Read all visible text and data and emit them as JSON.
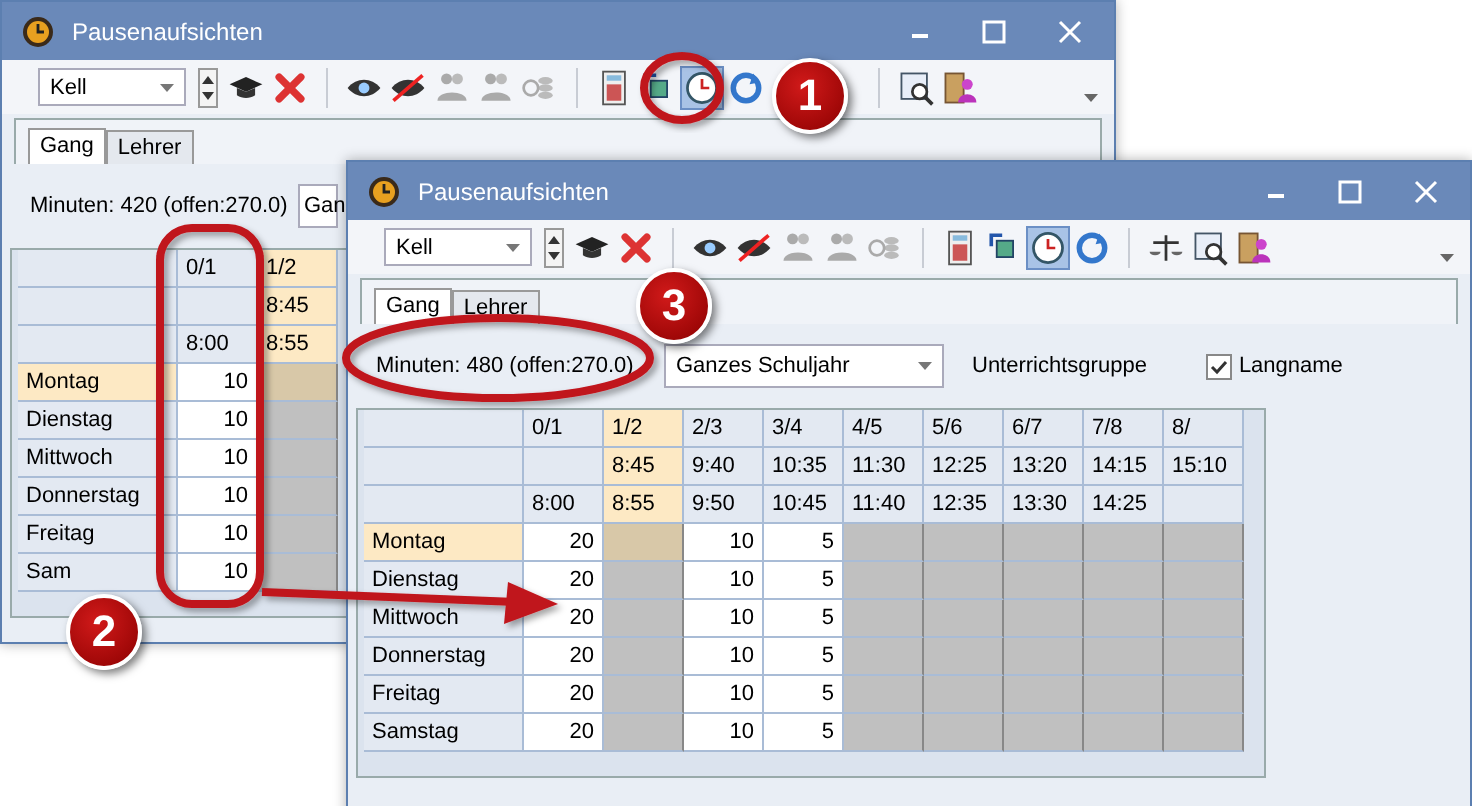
{
  "windows": [
    {
      "title": "Pausenaufsichten",
      "teacher_select": {
        "value": "Kell"
      },
      "toolbar": [
        {
          "kind": "cap",
          "selected": false
        },
        {
          "kind": "delete",
          "selected": false
        },
        {
          "kind": "eye",
          "selected": false
        },
        {
          "kind": "eye-off",
          "selected": false
        },
        {
          "kind": "people",
          "selected": false
        },
        {
          "kind": "people",
          "selected": false
        },
        {
          "kind": "coins",
          "selected": false
        },
        {
          "kind": "calculator",
          "selected": false
        },
        {
          "kind": "rotate",
          "selected": false
        },
        {
          "kind": "clock",
          "selected": true
        },
        {
          "kind": "refresh",
          "selected": false
        },
        {
          "kind": "magnifier",
          "selected": false
        },
        {
          "kind": "door",
          "selected": false
        }
      ],
      "tabs": [
        {
          "label": "Gang",
          "selected": true
        },
        {
          "label": "Lehrer",
          "selected": false
        }
      ],
      "minutes": "Minuten: 420 (offen:270.0)",
      "period_select": {
        "value": "Gan"
      },
      "table": {
        "columns": [
          {
            "period": "0/1",
            "end": "8:00",
            "selected": false
          },
          {
            "period": "1/2",
            "start": "8:45",
            "end": "8:55",
            "selected": true
          }
        ],
        "rows": [
          {
            "day": "Montag",
            "selected": true,
            "cells": [
              {
                "text": "10",
                "blocked": false
              },
              {
                "blocked": true
              }
            ]
          },
          {
            "day": "Dienstag",
            "selected": false,
            "cells": [
              {
                "text": "10",
                "blocked": false
              },
              {
                "blocked": true
              }
            ]
          },
          {
            "day": "Mittwoch",
            "selected": false,
            "cells": [
              {
                "text": "10",
                "blocked": false
              },
              {
                "blocked": true
              }
            ]
          },
          {
            "day": "Donnerstag",
            "selected": false,
            "cells": [
              {
                "text": "10",
                "blocked": false
              },
              {
                "blocked": true
              }
            ]
          },
          {
            "day": "Freitag",
            "selected": false,
            "cells": [
              {
                "text": "10",
                "blocked": false
              },
              {
                "blocked": true
              }
            ]
          },
          {
            "day": "Sam",
            "selected": false,
            "cells": [
              {
                "text": "10",
                "blocked": false
              },
              {
                "blocked": true
              }
            ]
          }
        ]
      }
    },
    {
      "title": "Pausenaufsichten",
      "teacher_select": {
        "value": "Kell"
      },
      "toolbar": [
        {
          "kind": "cap",
          "selected": false
        },
        {
          "kind": "delete",
          "selected": false
        },
        {
          "kind": "eye",
          "selected": false
        },
        {
          "kind": "eye-off",
          "selected": false
        },
        {
          "kind": "people",
          "selected": false
        },
        {
          "kind": "people",
          "selected": false
        },
        {
          "kind": "coins",
          "selected": false
        },
        {
          "kind": "calculator",
          "selected": false
        },
        {
          "kind": "rotate",
          "selected": false
        },
        {
          "kind": "clock",
          "selected": true
        },
        {
          "kind": "refresh",
          "selected": false
        },
        {
          "kind": "scales",
          "selected": false
        },
        {
          "kind": "magnifier",
          "selected": false
        },
        {
          "kind": "door",
          "selected": false
        }
      ],
      "tabs": [
        {
          "label": "Gang",
          "selected": true
        },
        {
          "label": "Lehrer",
          "selected": false
        }
      ],
      "minutes": "Minuten: 480 (offen:270.0)",
      "period_select": {
        "value": "Ganzes Schuljahr"
      },
      "group_label": "Unterrichtsgruppe",
      "longname": {
        "label": "Langname",
        "checked": true
      },
      "table": {
        "columns": [
          {
            "period": "0/1",
            "end": "8:00",
            "selected": false
          },
          {
            "period": "1/2",
            "start": "8:45",
            "end": "8:55",
            "selected": true
          },
          {
            "period": "2/3",
            "start": "9:40",
            "end": "9:50",
            "selected": false
          },
          {
            "period": "3/4",
            "start": "10:35",
            "end": "10:45",
            "selected": false
          },
          {
            "period": "4/5",
            "start": "11:30",
            "end": "11:40",
            "selected": false
          },
          {
            "period": "5/6",
            "start": "12:25",
            "end": "12:35",
            "selected": false
          },
          {
            "period": "6/7",
            "start": "13:20",
            "end": "13:30",
            "selected": false
          },
          {
            "period": "7/8",
            "start": "14:15",
            "end": "14:25",
            "selected": false
          },
          {
            "period": "8/",
            "start": "15:10",
            "selected": false
          }
        ],
        "rows": [
          {
            "day": "Montag",
            "selected": true,
            "cells": [
              {
                "text": "20",
                "blocked": false
              },
              {
                "blocked": true
              },
              {
                "text": "10",
                "blocked": false
              },
              {
                "text": "5",
                "blocked": false
              },
              {
                "blocked": true
              },
              {
                "blocked": true
              },
              {
                "blocked": true
              },
              {
                "blocked": true
              },
              {
                "blocked": true
              }
            ]
          },
          {
            "day": "Dienstag",
            "selected": false,
            "cells": [
              {
                "text": "20",
                "blocked": false
              },
              {
                "blocked": true
              },
              {
                "text": "10",
                "blocked": false
              },
              {
                "text": "5",
                "blocked": false
              },
              {
                "blocked": true
              },
              {
                "blocked": true
              },
              {
                "blocked": true
              },
              {
                "blocked": true
              },
              {
                "blocked": true
              }
            ]
          },
          {
            "day": "Mittwoch",
            "selected": false,
            "cells": [
              {
                "text": "20",
                "blocked": false
              },
              {
                "blocked": true
              },
              {
                "text": "10",
                "blocked": false
              },
              {
                "text": "5",
                "blocked": false
              },
              {
                "blocked": true
              },
              {
                "blocked": true
              },
              {
                "blocked": true
              },
              {
                "blocked": true
              },
              {
                "blocked": true
              }
            ]
          },
          {
            "day": "Donnerstag",
            "selected": false,
            "cells": [
              {
                "text": "20",
                "blocked": false
              },
              {
                "blocked": true
              },
              {
                "text": "10",
                "blocked": false
              },
              {
                "text": "5",
                "blocked": false
              },
              {
                "blocked": true
              },
              {
                "blocked": true
              },
              {
                "blocked": true
              },
              {
                "blocked": true
              },
              {
                "blocked": true
              }
            ]
          },
          {
            "day": "Freitag",
            "selected": false,
            "cells": [
              {
                "text": "20",
                "blocked": false
              },
              {
                "blocked": true
              },
              {
                "text": "10",
                "blocked": false
              },
              {
                "text": "5",
                "blocked": false
              },
              {
                "blocked": true
              },
              {
                "blocked": true
              },
              {
                "blocked": true
              },
              {
                "blocked": true
              },
              {
                "blocked": true
              }
            ]
          },
          {
            "day": "Samstag",
            "selected": false,
            "cells": [
              {
                "text": "20",
                "blocked": false
              },
              {
                "blocked": true
              },
              {
                "text": "10",
                "blocked": false
              },
              {
                "text": "5",
                "blocked": false
              },
              {
                "blocked": true
              },
              {
                "blocked": true
              },
              {
                "blocked": true
              },
              {
                "blocked": true
              },
              {
                "blocked": true
              }
            ]
          }
        ]
      }
    }
  ],
  "annotations": [
    {
      "number": "1"
    },
    {
      "number": "2"
    },
    {
      "number": "3"
    }
  ]
}
